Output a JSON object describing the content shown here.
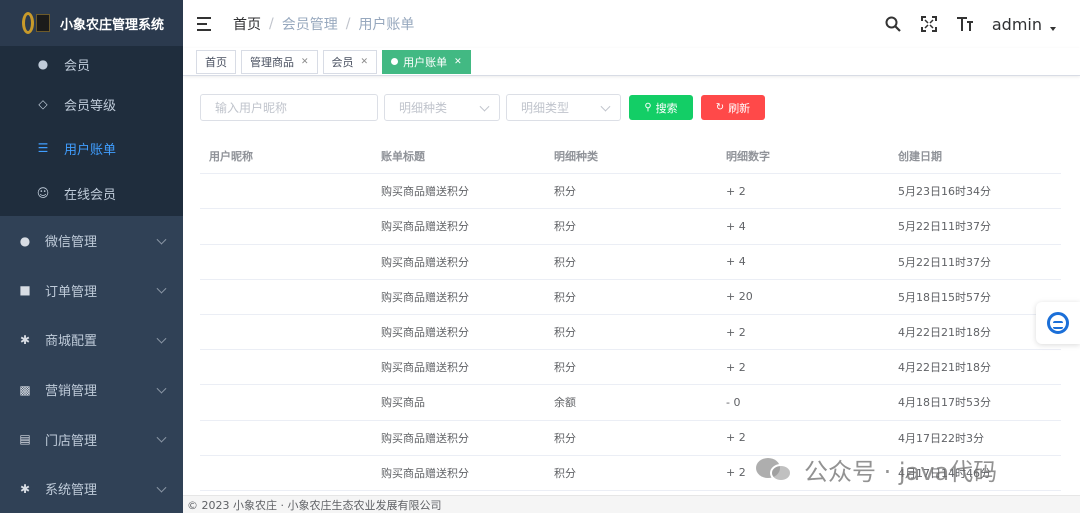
{
  "app": {
    "title": "小象农庄管理系统"
  },
  "sidebar": {
    "sub_items": [
      {
        "label": "会员",
        "icon": "users-icon"
      },
      {
        "label": "会员等级",
        "icon": "diamond-icon"
      },
      {
        "label": "用户账单",
        "icon": "list-icon",
        "active": true
      },
      {
        "label": "在线会员",
        "icon": "user-online-icon"
      }
    ],
    "menus": [
      {
        "label": "微信管理",
        "icon": "wechat-icon"
      },
      {
        "label": "订单管理",
        "icon": "lock-icon"
      },
      {
        "label": "商城配置",
        "icon": "gear-icon"
      },
      {
        "label": "营销管理",
        "icon": "chart-icon"
      },
      {
        "label": "门店管理",
        "icon": "store-icon"
      },
      {
        "label": "系统管理",
        "icon": "gear-icon"
      }
    ]
  },
  "header": {
    "breadcrumb": [
      "首页",
      "会员管理",
      "用户账单"
    ],
    "user": "admin"
  },
  "tags": [
    {
      "label": "首页",
      "closable": false
    },
    {
      "label": "管理商品",
      "closable": true
    },
    {
      "label": "会员",
      "closable": true
    },
    {
      "label": "用户账单",
      "closable": true,
      "active": true
    }
  ],
  "filters": {
    "nickname_placeholder": "输入用户昵称",
    "category_placeholder": "明细种类",
    "type_placeholder": "明细类型",
    "search_label": "搜索",
    "refresh_label": "刷新"
  },
  "table": {
    "columns": [
      "用户昵称",
      "账单标题",
      "明细种类",
      "明细数字",
      "创建日期"
    ],
    "rows": [
      [
        "",
        "购买商品赠送积分",
        "积分",
        "+ 2",
        "5月23日16时34分"
      ],
      [
        "",
        "购买商品赠送积分",
        "积分",
        "+ 4",
        "5月22日11时37分"
      ],
      [
        "",
        "购买商品赠送积分",
        "积分",
        "+ 4",
        "5月22日11时37分"
      ],
      [
        "",
        "购买商品赠送积分",
        "积分",
        "+ 20",
        "5月18日15时57分"
      ],
      [
        "",
        "购买商品赠送积分",
        "积分",
        "+ 2",
        "4月22日21时18分"
      ],
      [
        "",
        "购买商品赠送积分",
        "积分",
        "+ 2",
        "4月22日21时18分"
      ],
      [
        "",
        "购买商品",
        "余额",
        "- 0",
        "4月18日17时53分"
      ],
      [
        "",
        "购买商品赠送积分",
        "积分",
        "+ 2",
        "4月17日22时3分"
      ],
      [
        "",
        "购买商品赠送积分",
        "积分",
        "+ 2",
        "4月17日14时46分"
      ]
    ]
  },
  "footer": {
    "text": "© 2023 小象农庄 · 小象农庄生态农业发展有限公司"
  },
  "watermark": {
    "text": "公众号 · java代码"
  },
  "colors": {
    "sidebar": "#304156",
    "active": "#409eff",
    "tag_active": "#42b983",
    "search": "#13ce66",
    "refresh": "#ff4949"
  }
}
